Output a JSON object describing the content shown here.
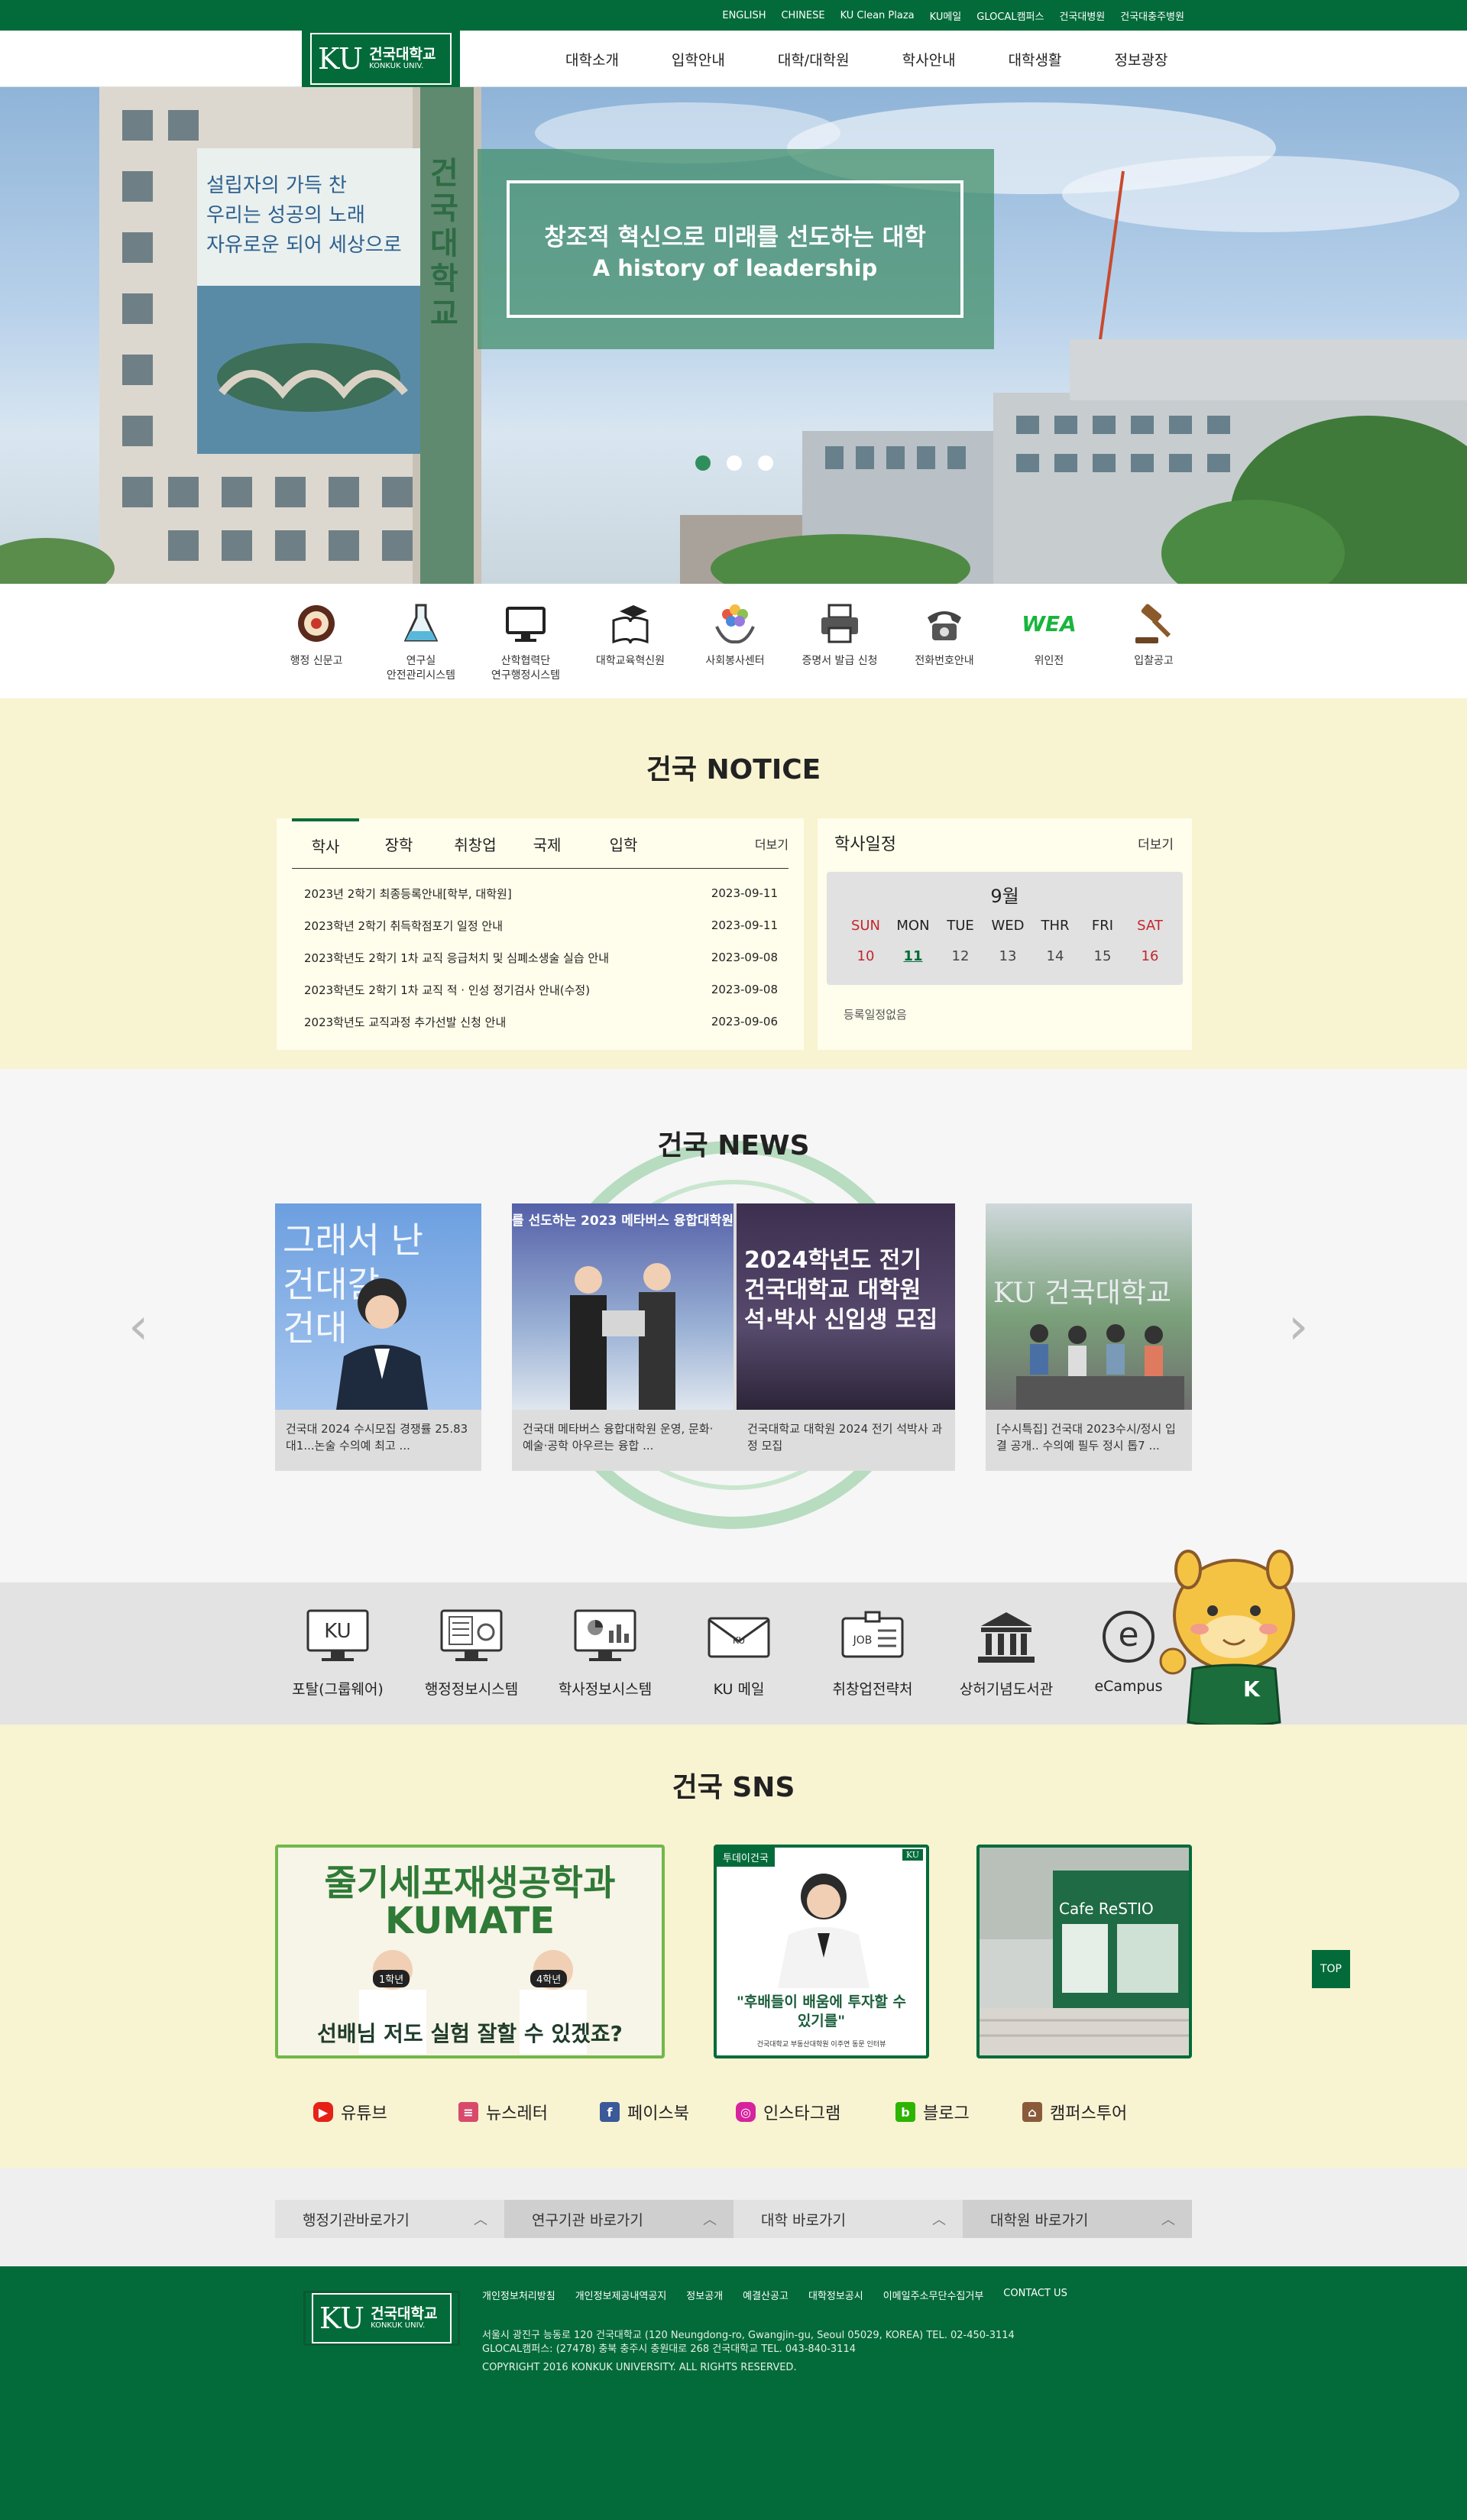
{
  "topbar": {
    "links": [
      "ENGLISH",
      "CHINESE",
      "KU Clean Plaza",
      "KU메일",
      "GLOCAL캠퍼스",
      "건국대병원",
      "건국대충주병원"
    ]
  },
  "logo": {
    "mark": "KU",
    "name_ko": "건국대학교",
    "name_en": "KONKUK UNIV."
  },
  "gnb": [
    "대학소개",
    "입학안내",
    "대학/대학원",
    "학사안내",
    "대학생활",
    "정보광장"
  ],
  "hero": {
    "title": "창조적 혁신으로 미래를 선도하는 대학",
    "subtitle": "A history of leadership",
    "banner_text": "설립자의 가득 찬\n우리는 성공의 노래\n자유로운 되어 세상으로",
    "building_sign": "건국대학교",
    "active_slide": 1,
    "slide_count": 3
  },
  "quick_links": [
    {
      "label": "행정 신문고",
      "icon": "drum-icon"
    },
    {
      "label": "연구실\n안전관리시스템",
      "icon": "flask-icon"
    },
    {
      "label": "산학협력단\n연구행정시스템",
      "icon": "monitor-icon"
    },
    {
      "label": "대학교육혁신원",
      "icon": "book-cap-icon"
    },
    {
      "label": "사회봉사센터",
      "icon": "hands-icon"
    },
    {
      "label": "증명서 발급 신청",
      "icon": "printer-icon"
    },
    {
      "label": "전화번호안내",
      "icon": "phone-icon"
    },
    {
      "label": "위인전",
      "icon": "wea-logo-icon",
      "text": "WEA"
    },
    {
      "label": "입찰공고",
      "icon": "gavel-icon"
    }
  ],
  "notice": {
    "title": "건국 NOTICE",
    "tabs": [
      "학사",
      "장학",
      "취창업",
      "국제",
      "입학"
    ],
    "active_tab": 0,
    "more": "더보기",
    "items": [
      {
        "title": "2023년 2학기 최종등록안내[학부, 대학원]",
        "date": "2023-09-11"
      },
      {
        "title": "2023학년 2학기 취득학점포기 일정 안내",
        "date": "2023-09-11"
      },
      {
        "title": "2023학년도 2학기 1차 교직 응급처치 및 심폐소생술 실습 안내",
        "date": "2023-09-08"
      },
      {
        "title": "2023학년도 2학기 1차 교직 적 · 인성 정기검사 안내(수정)",
        "date": "2023-09-08"
      },
      {
        "title": "2023학년도 교직과정 추가선발 신청 안내",
        "date": "2023-09-06"
      }
    ]
  },
  "calendar": {
    "title": "학사일정",
    "more": "더보기",
    "month": "9월",
    "weekdays": [
      "SUN",
      "MON",
      "TUE",
      "WED",
      "THR",
      "FRI",
      "SAT"
    ],
    "days": [
      "10",
      "11",
      "12",
      "13",
      "14",
      "15",
      "16"
    ],
    "today_index": 1,
    "empty_text": "등록일정없음",
    "colors": {
      "sun": "#c2272d",
      "sat": "#c2272d",
      "today": "#036b3a"
    }
  },
  "news": {
    "title": "건국 NEWS",
    "cards": [
      {
        "caption": "건국대 2024 수시모집 경쟁률 25.83대1...논술 수의예 최고 ...",
        "image_text": "그래서 난\n건대갈\n건대"
      },
      {
        "caption": "건국대 메타버스 융합대학원 운영, 문화·예술·공학 아우르는 융합 ...",
        "image_text": "를 선도하는 2023 메타버스 융합대학원"
      },
      {
        "caption": "건국대학교 대학원 2024 전기 석박사 과정 모집",
        "image_text": "2024학년도 전기\n건국대학교 대학원\n석·박사 신입생 모집"
      },
      {
        "caption": "[수시특집] 건국대 2023수시/정시 입결 공개.. 수의예 필두 정시 톱7 ...",
        "image_text": "KU 건국대학교"
      }
    ]
  },
  "systems": [
    {
      "label": "포탈(그룹웨어)",
      "icon": "ku-monitor-icon",
      "mark": "KU"
    },
    {
      "label": "행정정보시스템",
      "icon": "admin-monitor-icon"
    },
    {
      "label": "학사정보시스템",
      "icon": "chart-monitor-icon"
    },
    {
      "label": "KU 메일",
      "icon": "mail-icon",
      "mark": "KU"
    },
    {
      "label": "취창업전략처",
      "icon": "job-icon",
      "mark": "JOB"
    },
    {
      "label": "상허기념도서관",
      "icon": "library-icon"
    },
    {
      "label": "eCampus",
      "icon": "ecampus-icon",
      "mark": "e"
    }
  ],
  "mascot": {
    "badge": "K"
  },
  "sns": {
    "title": "건국 SNS",
    "images": [
      {
        "line1": "줄기세포재생공학과",
        "line2": "KUMATE",
        "tag1": "1학년",
        "tag2": "4학년",
        "bottom": "선배님 저도 실험 잘할 수 있겠죠?"
      },
      {
        "tag": "투데이건국",
        "mark": "KU",
        "quote": "\"후배들이 배움에 투자할 수\n있기를\"",
        "small": "건국대학교 부동산대학원 이주연 동문 인터뷰"
      },
      {
        "sign": "Cafe ReSTIO"
      }
    ],
    "links": [
      {
        "label": "유튜브",
        "icon": "youtube-icon",
        "color": "#e62117",
        "glyph": "▶"
      },
      {
        "label": "뉴스레터",
        "icon": "newsletter-icon",
        "color": "#d84a6b",
        "glyph": "≡"
      },
      {
        "label": "페이스북",
        "icon": "facebook-icon",
        "color": "#3b5998",
        "glyph": "f"
      },
      {
        "label": "인스타그램",
        "icon": "instagram-icon",
        "color": "#d6249f",
        "glyph": "◎"
      },
      {
        "label": "블로그",
        "icon": "blog-icon",
        "color": "#2db400",
        "glyph": "b"
      },
      {
        "label": "캠퍼스투어",
        "icon": "campus-tour-icon",
        "color": "#8a5a3b",
        "glyph": "⌂"
      }
    ]
  },
  "family_sites": [
    "행정기관바로가기",
    "연구기관 바로가기",
    "대학 바로가기",
    "대학원 바로가기"
  ],
  "top_button": "TOP",
  "footer": {
    "links": [
      "개인정보처리방침",
      "개인정보제공내역공지",
      "정보공개",
      "예결산공고",
      "대학정보공시",
      "이메일주소무단수집거부",
      "CONTACT US"
    ],
    "address1": "서울시 광진구 능동로 120 건국대학교 (120 Neungdong-ro, Gwangjin-gu, Seoul 05029, KOREA) TEL. 02-450-3114",
    "address2": "GLOCAL캠퍼스: (27478) 충북 충주시 충원대로 268 건국대학교 TEL. 043-840-3114",
    "copyright": "COPYRIGHT 2016 KONKUK UNIVERSITY. ALL RIGHTS RESERVED."
  }
}
